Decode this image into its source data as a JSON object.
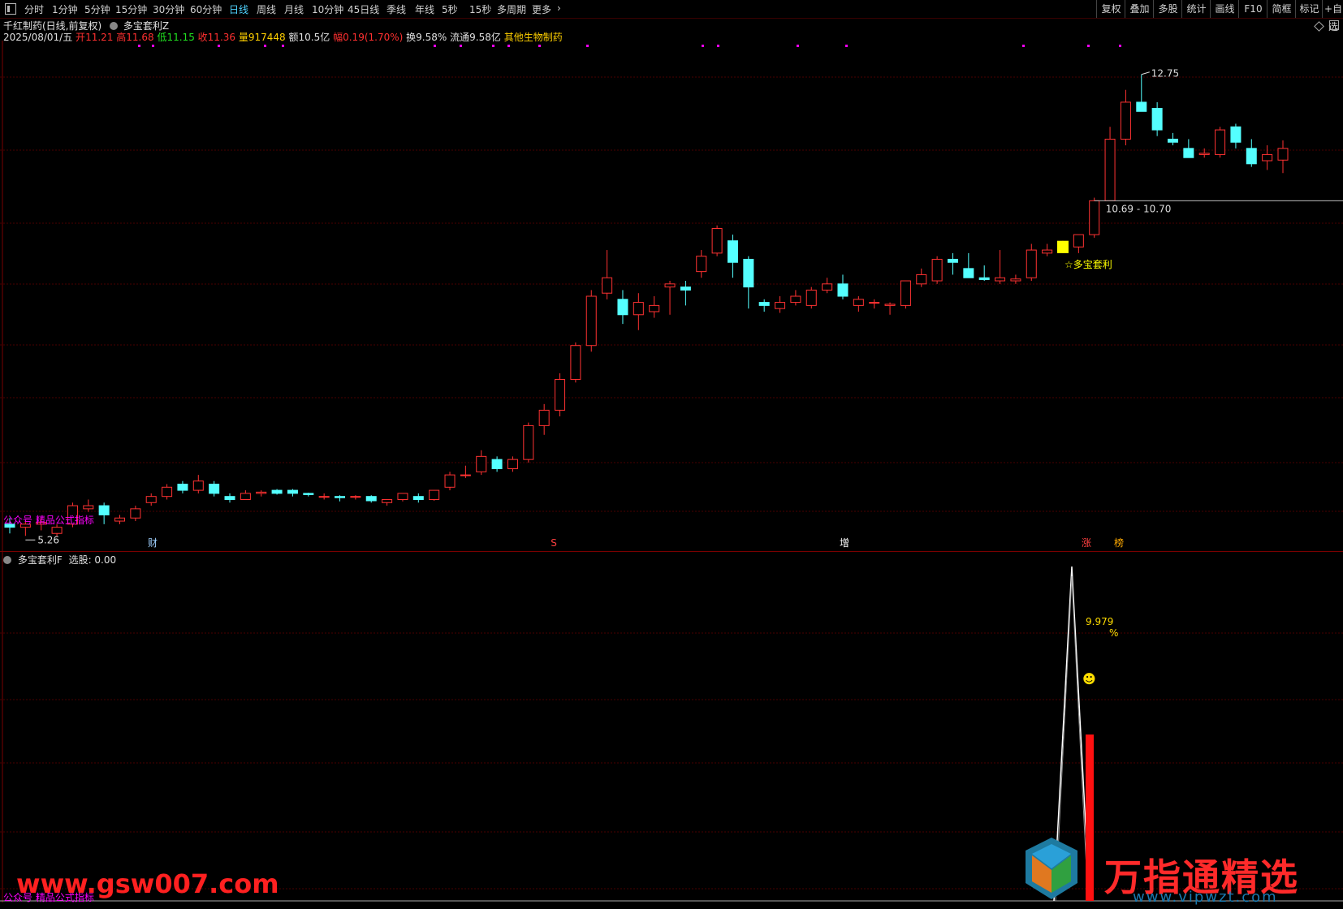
{
  "toolbar": {
    "sidebar_icon": "panel-toggle-icon",
    "periods": [
      "分时",
      "1分钟",
      "5分钟",
      "15分钟",
      "30分钟",
      "60分钟",
      "日线",
      "周线",
      "月线",
      "10分钟",
      "45日线",
      "季线",
      "年线",
      "5秒",
      "15秒",
      "多周期",
      "更多"
    ],
    "active_period": "日线",
    "more_icon": "chevron-right-icon",
    "right_buttons": [
      "复权",
      "叠加",
      "多股",
      "统计",
      "画线",
      "F10",
      "简框",
      "标记",
      "+自选"
    ]
  },
  "stock": {
    "title": "千红制药(日线,前复权)",
    "indicator_name": "多宝套利Z",
    "date": "2025/08/01/五",
    "open_label": "开",
    "open": "11.21",
    "high_label": "高",
    "high": "11.68",
    "low_label": "低",
    "low": "11.15",
    "close_label": "收",
    "close": "11.36",
    "volume_label": "量",
    "volume": "917448",
    "amount_label": "额",
    "amount": "10.5亿",
    "change_label": "幅",
    "change": "0.19(1.70%)",
    "turnover_label": "换",
    "turnover": "9.58%",
    "float_label": "流通",
    "float": "9.58亿",
    "sector": "其他生物制药"
  },
  "main_chart": {
    "high_marker": "12.75",
    "low_marker": "5.26",
    "range_label": "10.69 - 10.70",
    "signal_label": "☆多宝套利",
    "watermark_left": "公众号 精品公式指标",
    "event_markers": [
      "财",
      "S",
      "增",
      "涨",
      "榜"
    ],
    "colors": {
      "up": "#ff3232",
      "down": "#54ffff",
      "signal": "#ffff00",
      "grid": "#4a0000",
      "dots": "#ff00ff"
    }
  },
  "sub_chart": {
    "title": "多宝套利F",
    "select_label": "选股: 0.00",
    "peak_value": "9.979",
    "peak_unit": "%",
    "smiley": "☻",
    "watermark_left": "公众号 精品公式指标"
  },
  "watermarks": {
    "site_left": "www.gsw007.com",
    "brand_right": "万指通精选",
    "site_right": "www.vipwzt.com"
  },
  "chart_data": {
    "type": "candlestick",
    "series": [
      {
        "name": "candles",
        "values": [
          [
            5.45,
            5.55,
            5.3,
            5.4
          ],
          [
            5.4,
            5.5,
            5.26,
            5.45
          ],
          [
            5.45,
            5.55,
            5.35,
            5.48
          ],
          [
            5.3,
            5.45,
            5.25,
            5.4
          ],
          [
            5.45,
            5.8,
            5.4,
            5.75
          ],
          [
            5.7,
            5.85,
            5.65,
            5.75
          ],
          [
            5.75,
            5.8,
            5.45,
            5.6
          ],
          [
            5.5,
            5.6,
            5.45,
            5.55
          ],
          [
            5.55,
            5.75,
            5.5,
            5.7
          ],
          [
            5.8,
            5.95,
            5.75,
            5.9
          ],
          [
            5.9,
            6.1,
            5.85,
            6.05
          ],
          [
            6.1,
            6.15,
            5.95,
            6.0
          ],
          [
            6.0,
            6.25,
            5.95,
            6.15
          ],
          [
            6.1,
            6.15,
            5.9,
            5.95
          ],
          [
            5.9,
            5.95,
            5.8,
            5.85
          ],
          [
            5.85,
            6.0,
            5.85,
            5.95
          ],
          [
            5.95,
            6.0,
            5.9,
            5.97
          ],
          [
            6.0,
            6.02,
            5.93,
            5.95
          ],
          [
            6.0,
            6.02,
            5.9,
            5.95
          ],
          [
            5.95,
            5.96,
            5.9,
            5.93
          ],
          [
            5.9,
            5.95,
            5.85,
            5.9
          ],
          [
            5.9,
            5.92,
            5.82,
            5.88
          ],
          [
            5.9,
            5.92,
            5.85,
            5.9
          ],
          [
            5.9,
            5.92,
            5.8,
            5.83
          ],
          [
            5.8,
            5.85,
            5.75,
            5.85
          ],
          [
            5.85,
            5.95,
            5.82,
            5.95
          ],
          [
            5.9,
            5.95,
            5.8,
            5.85
          ],
          [
            5.85,
            6.0,
            5.83,
            6.0
          ],
          [
            6.05,
            6.3,
            6.0,
            6.25
          ],
          [
            6.25,
            6.4,
            6.2,
            6.25
          ],
          [
            6.3,
            6.65,
            6.25,
            6.55
          ],
          [
            6.5,
            6.55,
            6.3,
            6.35
          ],
          [
            6.35,
            6.55,
            6.3,
            6.5
          ],
          [
            6.5,
            7.1,
            6.45,
            7.05
          ],
          [
            7.05,
            7.4,
            6.9,
            7.3
          ],
          [
            7.3,
            7.9,
            7.2,
            7.8
          ],
          [
            7.8,
            8.4,
            7.75,
            8.35
          ],
          [
            8.35,
            9.25,
            8.25,
            9.15
          ],
          [
            9.2,
            9.9,
            9.1,
            9.45
          ],
          [
            9.1,
            9.25,
            8.7,
            8.85
          ],
          [
            8.85,
            9.2,
            8.6,
            9.05
          ],
          [
            8.9,
            9.15,
            8.8,
            9.0
          ],
          [
            9.3,
            9.4,
            8.85,
            9.35
          ],
          [
            9.3,
            9.4,
            9.0,
            9.25
          ],
          [
            9.55,
            9.9,
            9.45,
            9.8
          ],
          [
            9.85,
            10.3,
            9.8,
            10.25
          ],
          [
            10.05,
            10.15,
            9.45,
            9.7
          ],
          [
            9.75,
            9.8,
            8.95,
            9.3
          ],
          [
            9.05,
            9.1,
            8.9,
            9.0
          ],
          [
            8.95,
            9.15,
            8.88,
            9.05
          ],
          [
            9.05,
            9.25,
            9.0,
            9.15
          ],
          [
            9.0,
            9.3,
            8.95,
            9.25
          ],
          [
            9.25,
            9.45,
            9.2,
            9.35
          ],
          [
            9.35,
            9.5,
            9.1,
            9.15
          ],
          [
            9.0,
            9.15,
            8.9,
            9.1
          ],
          [
            9.05,
            9.1,
            8.95,
            9.05
          ],
          [
            9.0,
            9.05,
            8.85,
            9.02
          ],
          [
            9.0,
            9.4,
            8.95,
            9.4
          ],
          [
            9.35,
            9.6,
            9.3,
            9.5
          ],
          [
            9.4,
            9.8,
            9.35,
            9.75
          ],
          [
            9.75,
            9.85,
            9.5,
            9.7
          ],
          [
            9.6,
            9.85,
            9.5,
            9.45
          ],
          [
            9.45,
            9.65,
            9.4,
            9.42
          ],
          [
            9.4,
            9.9,
            9.35,
            9.45
          ],
          [
            9.4,
            9.5,
            9.35,
            9.43
          ],
          [
            9.45,
            10.0,
            9.4,
            9.9
          ],
          [
            9.85,
            10.0,
            9.8,
            9.9
          ],
          [
            9.9,
            10.05,
            9.85,
            9.95
          ],
          [
            9.95,
            10.05,
            9.85,
            10.15
          ],
          [
            10.15,
            10.75,
            10.1,
            10.7
          ],
          [
            10.7,
            11.9,
            10.7,
            11.7
          ],
          [
            11.7,
            12.5,
            11.6,
            12.3
          ],
          [
            12.3,
            12.75,
            12.15,
            12.15
          ],
          [
            12.2,
            12.3,
            11.75,
            11.85
          ],
          [
            11.7,
            11.8,
            11.6,
            11.65
          ],
          [
            11.55,
            11.7,
            11.45,
            11.4
          ],
          [
            11.45,
            11.55,
            11.4,
            11.47
          ],
          [
            11.45,
            11.9,
            11.4,
            11.85
          ],
          [
            11.9,
            11.95,
            11.55,
            11.65
          ],
          [
            11.55,
            11.7,
            11.25,
            11.3
          ],
          [
            11.35,
            11.6,
            11.2,
            11.45
          ],
          [
            11.36,
            11.68,
            11.15,
            11.55
          ]
        ]
      }
    ],
    "y_range": [
      5.0,
      13.3
    ],
    "high": 12.75,
    "low": 5.26,
    "sub_indicator": {
      "peak_value": 9.979,
      "unit": "%"
    }
  }
}
